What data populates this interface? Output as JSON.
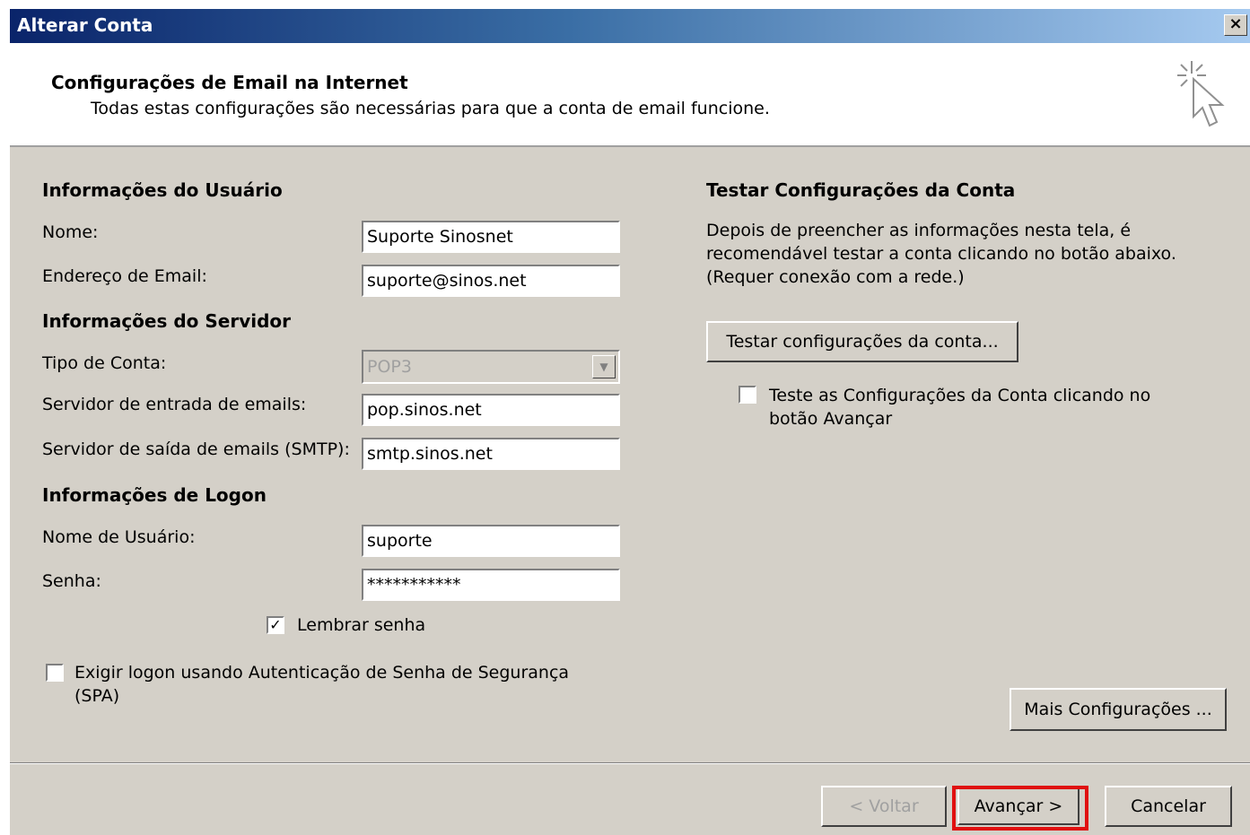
{
  "window": {
    "title": "Alterar Conta",
    "close_label": "×"
  },
  "header": {
    "title": "Configurações de Email na Internet",
    "subtitle": "Todas estas configurações são necessárias para que a conta de email funcione.",
    "icon": "wizard-cursor-icon"
  },
  "user_info": {
    "heading": "Informações do Usuário",
    "name_label": "Nome:",
    "name_value": "Suporte Sinosnet",
    "email_label": "Endereço de Email:",
    "email_value": "suporte@sinos.net"
  },
  "server_info": {
    "heading": "Informações do Servidor",
    "account_type_label": "Tipo de Conta:",
    "account_type_value": "POP3",
    "incoming_label": "Servidor de entrada de emails:",
    "incoming_value": "pop.sinos.net",
    "outgoing_label": "Servidor de saída de emails (SMTP):",
    "outgoing_value": "smtp.sinos.net"
  },
  "logon_info": {
    "heading": "Informações de Logon",
    "username_label": "Nome de Usuário:",
    "username_value": "suporte",
    "password_label": "Senha:",
    "password_value": "***********",
    "remember_label": "Lembrar senha",
    "remember_checked": true,
    "spa_label_line1": "Exigir logon usando Autenticação de Senha de Segurança",
    "spa_label_line2": "(SPA)",
    "spa_checked": false
  },
  "test": {
    "heading": "Testar Configurações da Conta",
    "desc_line1": "Depois de preencher as informações nesta tela, é",
    "desc_line2": "recomendável testar a conta clicando no botão abaixo.",
    "desc_line3": "(Requer conexão com a rede.)",
    "test_button": "Testar configurações da conta...",
    "auto_test_line1": "Teste as Configurações da Conta clicando no",
    "auto_test_line2": "botão Avançar",
    "auto_test_checked": false
  },
  "buttons": {
    "more_settings": "Mais Configurações ...",
    "back": "< Voltar",
    "next": "Avançar >",
    "cancel": "Cancelar"
  },
  "colors": {
    "highlight": "#e01010",
    "title_gradient_start": "#0a246a",
    "dialog_bg": "#d4d0c8"
  }
}
